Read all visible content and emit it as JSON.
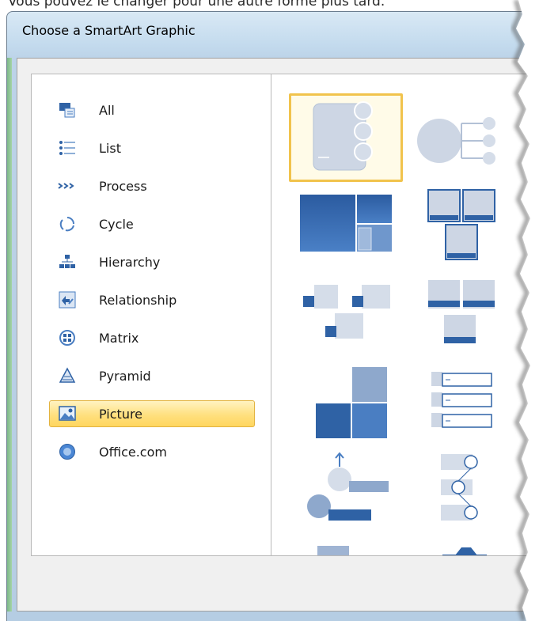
{
  "context": {
    "caption": "Vous pouvez le changer pour une autre forme plus tard."
  },
  "dialog": {
    "title": "Choose a SmartArt Graphic"
  },
  "categories": [
    {
      "label": "All",
      "icon": "all-icon"
    },
    {
      "label": "List",
      "icon": "list-icon"
    },
    {
      "label": "Process",
      "icon": "process-icon"
    },
    {
      "label": "Cycle",
      "icon": "cycle-icon"
    },
    {
      "label": "Hierarchy",
      "icon": "hierarchy-icon"
    },
    {
      "label": "Relationship",
      "icon": "relationship-icon"
    },
    {
      "label": "Matrix",
      "icon": "matrix-icon"
    },
    {
      "label": "Pyramid",
      "icon": "pyramid-icon"
    },
    {
      "label": "Picture",
      "icon": "picture-icon",
      "selected": true
    },
    {
      "label": "Office.com",
      "icon": "office-com-icon"
    }
  ],
  "colors": {
    "selection_fill": "#ffe07f",
    "selection_border": "#e3b340",
    "shape_light": "#cdd6e4",
    "shape_dark": "#2f62a5"
  }
}
